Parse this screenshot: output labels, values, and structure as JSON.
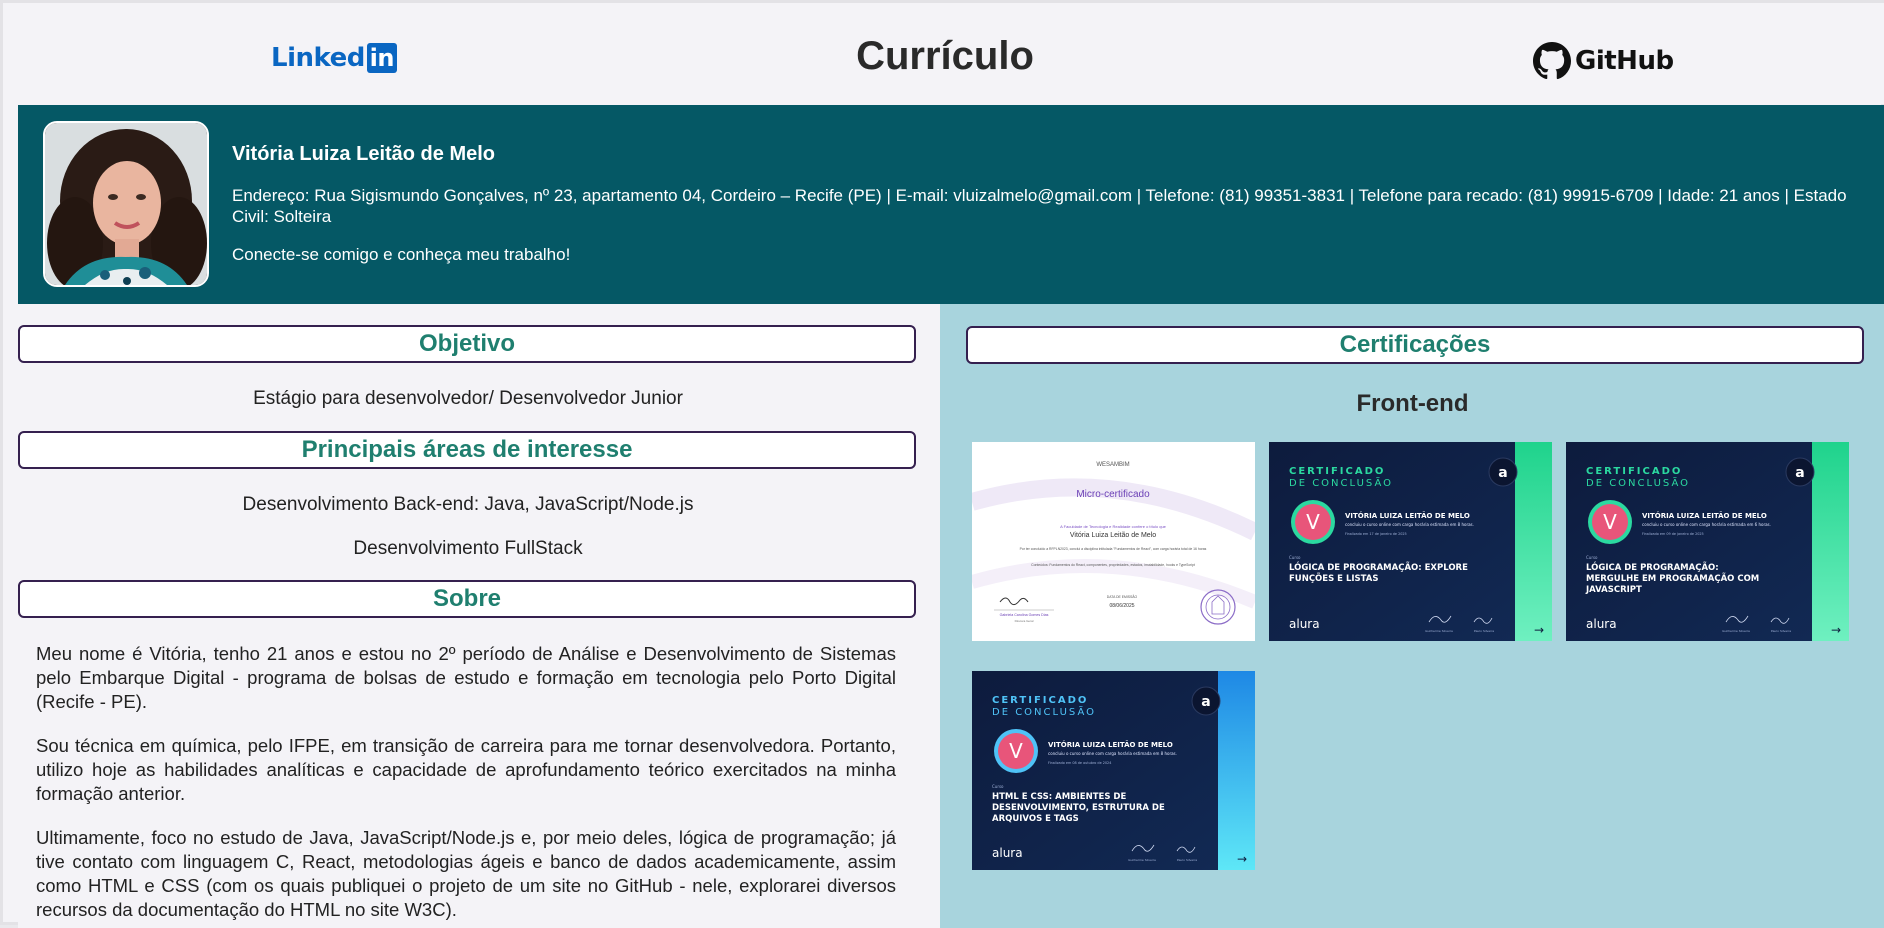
{
  "header": {
    "linkedin_label": "Linked",
    "linkedin_box": "in",
    "title": "Currículo",
    "github_label": "GitHub"
  },
  "profile": {
    "name": "Vitória Luiza Leitão de Melo",
    "info": "Endereço: Rua Sigismundo Gonçalves, nº 23, apartamento 04, Cordeiro – Recife (PE) | E-mail: vluizalmelo@gmail.com | Telefone: (81) 99351-3831 | Telefone para recado: (81) 99915-6709 | Idade: 21 anos | Estado Civil: Solteira",
    "cta": "Conecte-se comigo e conheça meu trabalho!"
  },
  "objetivo": {
    "heading": "Objetivo",
    "text": "Estágio para desenvolvedor/ Desenvolvedor Junior"
  },
  "interesses": {
    "heading": "Principais áreas de interesse",
    "items": [
      "Desenvolvimento Back-end: Java, JavaScript/Node.js",
      "Desenvolvimento FullStack"
    ]
  },
  "sobre": {
    "heading": "Sobre",
    "paragraphs": [
      "Meu nome é Vitória, tenho 21 anos e estou no 2º período de Análise e Desenvolvimento de Sistemas pelo Embarque Digital - programa de bolsas de estudo e formação em tecnologia pelo Porto Digital (Recife - PE).",
      "Sou técnica em química, pelo IFPE, em transição de carreira para me tornar desenvolvedora. Portanto, utilizo hoje as habilidades analíticas e capacidade de aprofundamento teórico exercitados na minha formação anterior.",
      "Ultimamente, foco no estudo de Java, JavaScript/Node.js e, por meio deles, lógica de programação; já tive contato com linguagem C, React, metodologias ágeis e banco de dados academicamente, assim como HTML e CSS (com os quais publiquei o projeto de um site no GitHub - nele, explorarei diversos recursos da documentação do HTML no site W3C)."
    ]
  },
  "certificacoes": {
    "heading": "Certificações",
    "subheading": "Front-end",
    "cards": [
      {
        "kind": "micro",
        "issuer": "WESAMBIM",
        "title": "Micro-certificado",
        "line1": "A Faculdade de Tecnologia e Realidade confere o título que",
        "name": "Vitória Luiza Leitão de Melo",
        "body": "Por ter concluído a RFPLN2023, conclui a disciplina intitulada \"Fundamentos de React\", com carga horária total de 16 horas",
        "content": "Conteúdos: Fundamentos do React, componentes, propriedades, estados, imutabilidade, hooks e TypeScript",
        "signer": "Gabriela Carolina Gomes Dias",
        "signer_role": "Diretora Geral",
        "date_label": "DATA DE EMISSÃO",
        "date": "08/06/2025"
      },
      {
        "kind": "alura",
        "heading1": "CERTIFICADO",
        "heading2": "DE CONCLUSÃO",
        "name": "VITÓRIA LUIZA LEITÃO DE MELO",
        "sub": "concluiu o curso online com carga horária estimada em 8 horas.",
        "small": "Finalizado em 17 de janeiro de 2025",
        "curso": "Curso",
        "course": [
          "LÓGICA DE PROGRAMAÇÃO: EXPLORE",
          "FUNÇÕES E LISTAS"
        ],
        "brand": "alura",
        "initial": "V",
        "logo": "a",
        "accent": "#1fd38c",
        "sig1": "Guilherme Silveira",
        "sig2": "Paulo Silveira",
        "arrow": "→"
      },
      {
        "kind": "alura",
        "heading1": "CERTIFICADO",
        "heading2": "DE CONCLUSÃO",
        "name": "VITÓRIA LUIZA LEITÃO DE MELO",
        "sub": "concluiu o curso online com carga horária estimada em 6 horas.",
        "small": "Finalizado em 09 de janeiro de 2025",
        "curso": "Curso",
        "course": [
          "LÓGICA DE PROGRAMAÇÃO:",
          "MERGULHE EM PROGRAMAÇÃO COM",
          "JAVASCRIPT"
        ],
        "brand": "alura",
        "initial": "V",
        "logo": "a",
        "accent": "#1fd38c",
        "sig1": "Guilherme Silveira",
        "sig2": "Paulo Silveira",
        "arrow": "→"
      },
      {
        "kind": "alura",
        "heading1": "CERTIFICADO",
        "heading2": "DE CONCLUSÃO",
        "name": "VITÓRIA LUIZA LEITÃO DE MELO",
        "sub": "concluiu o curso online com carga horária estimada em 8 horas.",
        "small": "Finalizado em 08 de outubro de 2024",
        "curso": "Curso",
        "course": [
          "HTML E CSS: AMBIENTES DE",
          "DESENVOLVIMENTO, ESTRUTURA DE",
          "ARQUIVOS E TAGS"
        ],
        "brand": "alura",
        "initial": "V",
        "logo": "a",
        "accent": "#29b6f6",
        "sig1": "Guilherme Silveira",
        "sig2": "Paulo Silveira",
        "arrow": "→"
      }
    ]
  },
  "colors": {
    "profile_band": "#055865",
    "heading_text": "#1f7f6f",
    "heading_border": "#35204f",
    "cert_panel": "#a8d4dd"
  }
}
